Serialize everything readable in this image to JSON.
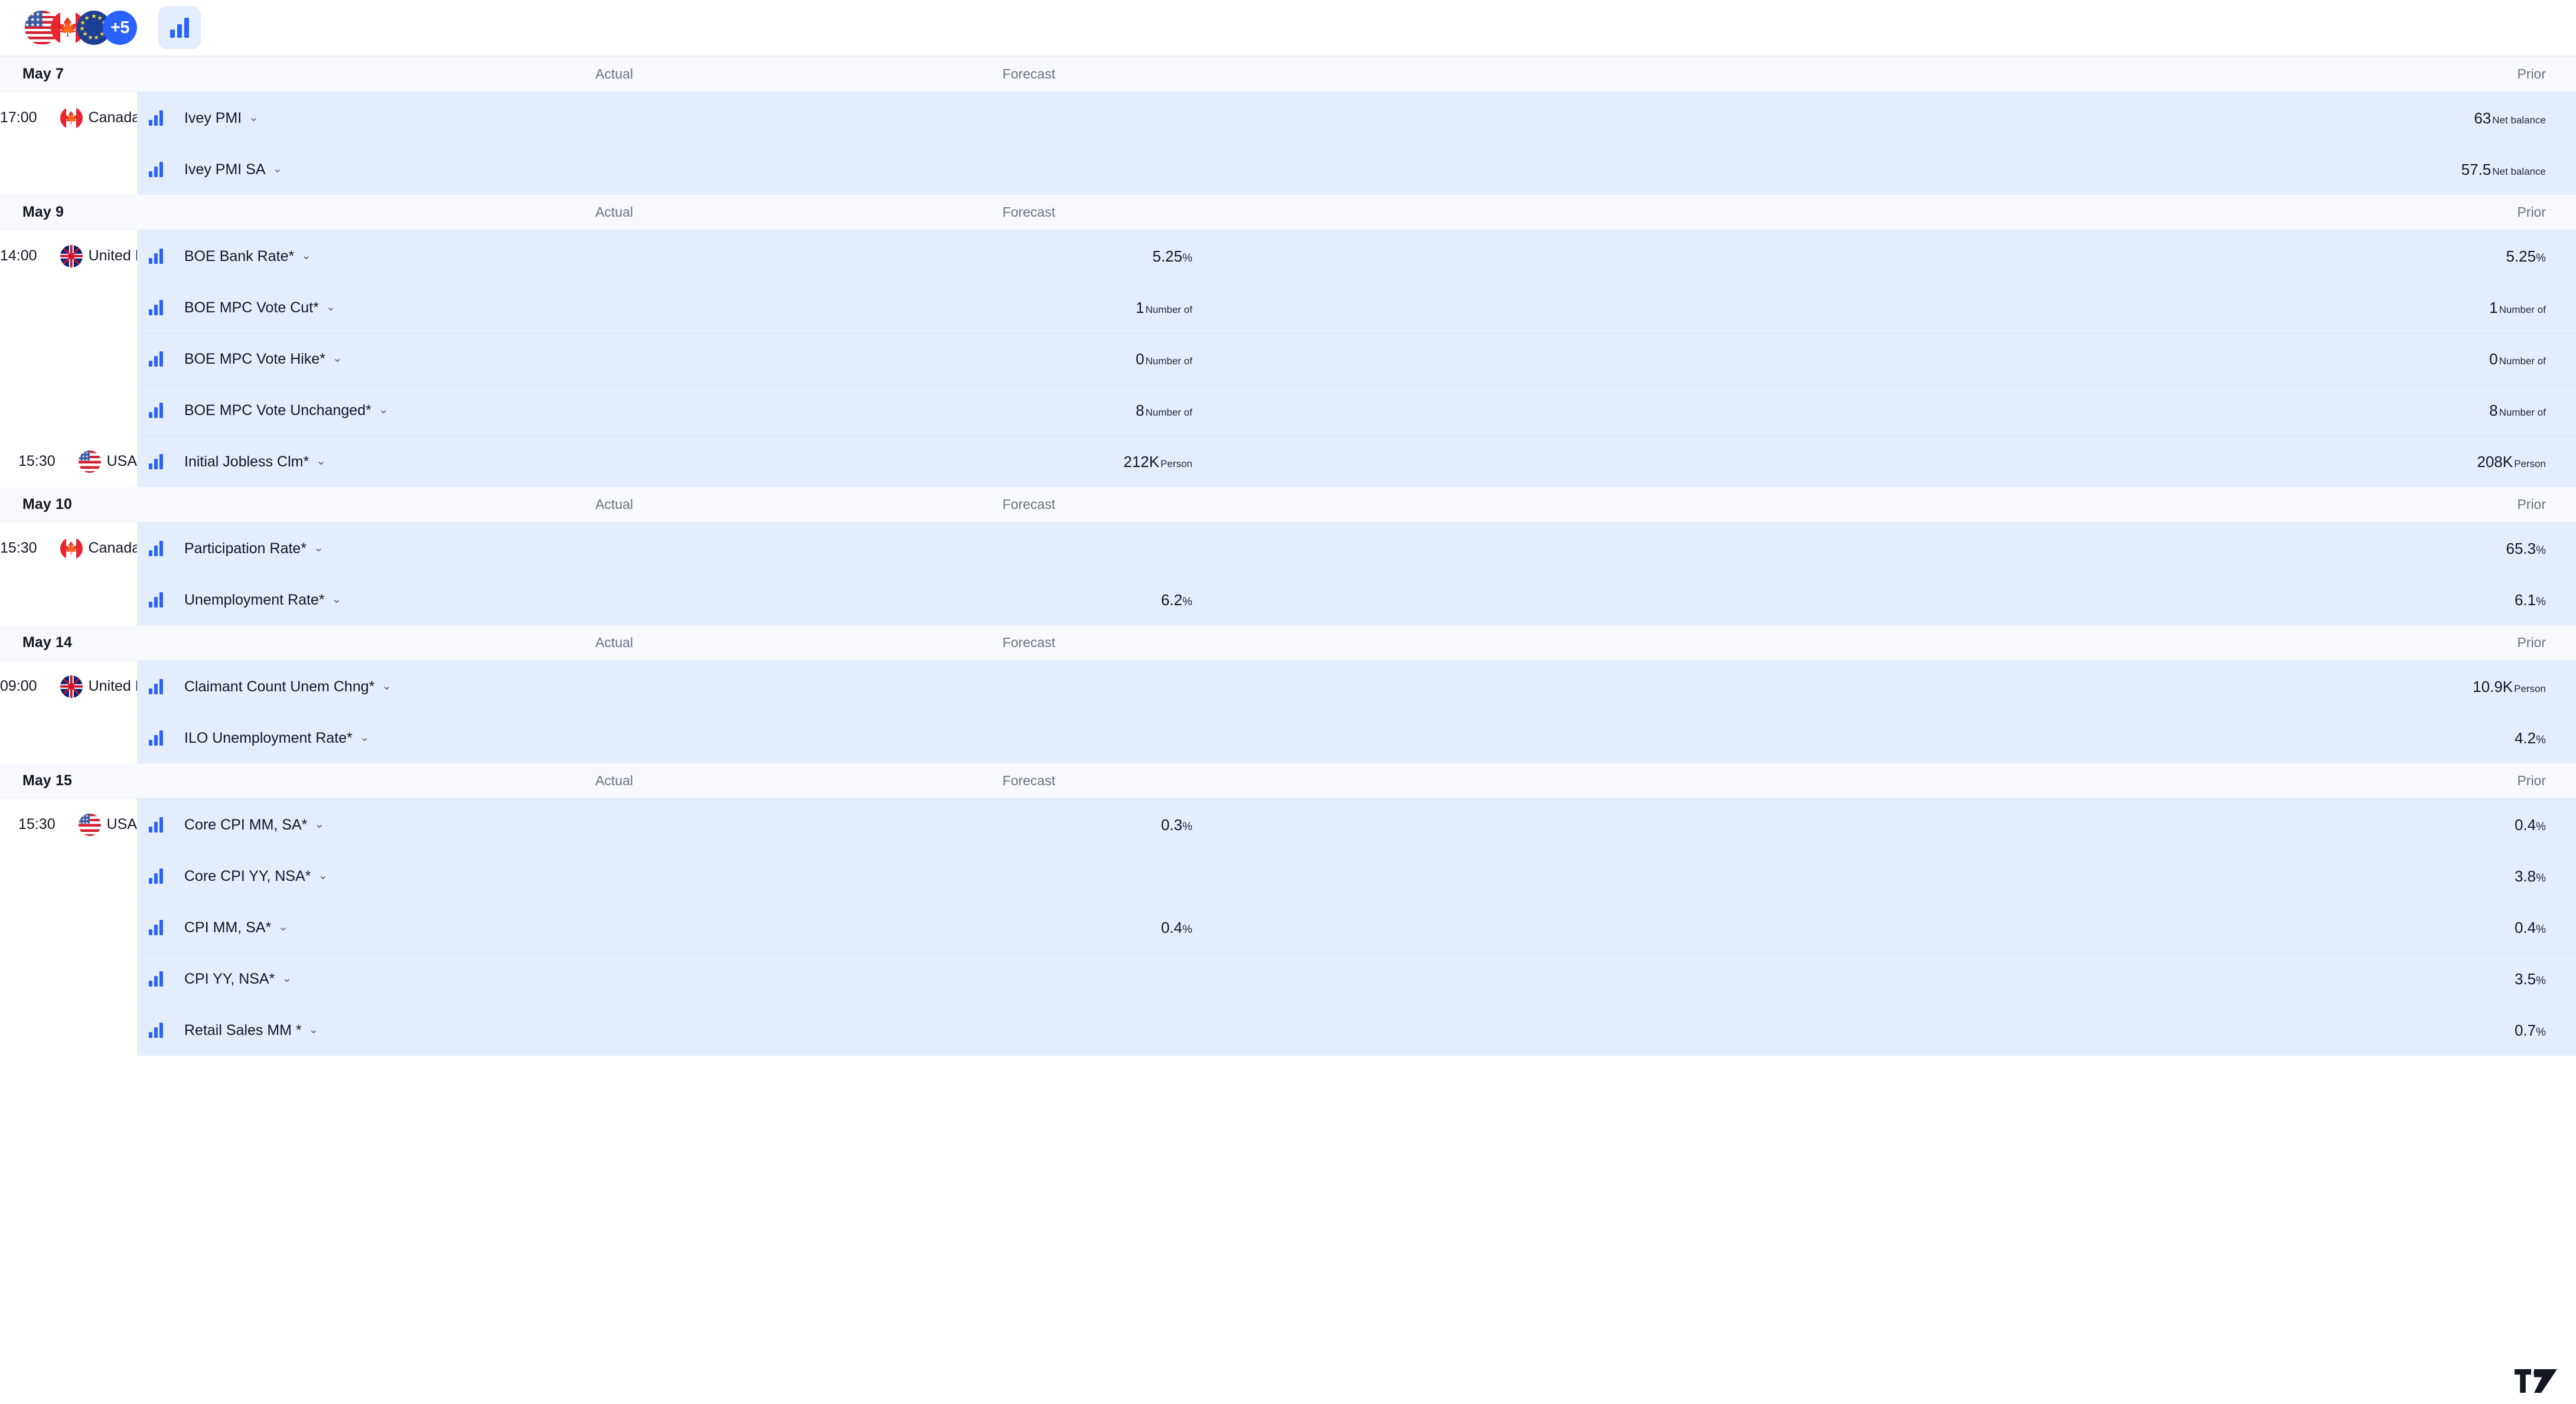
{
  "toolbar": {
    "country_filter": {
      "name": "country-filter",
      "flags": [
        "usa",
        "canada",
        "eu"
      ],
      "more_label": "+5"
    },
    "importance_filter": {
      "name": "importance-filter",
      "icon": "bar-chart-icon"
    }
  },
  "columns": {
    "actual": "Actual",
    "forecast": "Forecast",
    "prior": "Prior"
  },
  "accent": "#2962ff",
  "row_bg": "#e3edfb",
  "groups": [
    {
      "date": "May 7",
      "events": [
        {
          "time": "17:00",
          "country": "Canada",
          "flag": "canada",
          "name": "Ivey PMI",
          "actual": "",
          "actual_unit": "",
          "forecast": "",
          "forecast_unit": "",
          "prior": "63",
          "prior_unit": "Net balance"
        },
        {
          "time": "",
          "country": "",
          "flag": "",
          "name": "Ivey PMI SA",
          "actual": "",
          "actual_unit": "",
          "forecast": "",
          "forecast_unit": "",
          "prior": "57.5",
          "prior_unit": "Net balance"
        }
      ]
    },
    {
      "date": "May 9",
      "events": [
        {
          "time": "14:00",
          "country": "United Kingdom",
          "flag": "uk",
          "name": "BOE Bank Rate*",
          "actual": "",
          "actual_unit": "",
          "forecast": "5.25",
          "forecast_unit": "%",
          "prior": "5.25",
          "prior_unit": "%"
        },
        {
          "time": "",
          "country": "",
          "flag": "",
          "name": "BOE MPC Vote Cut*",
          "actual": "",
          "actual_unit": "",
          "forecast": "1",
          "forecast_unit": "Number of",
          "prior": "1",
          "prior_unit": "Number of"
        },
        {
          "time": "",
          "country": "",
          "flag": "",
          "name": "BOE MPC Vote Hike*",
          "actual": "",
          "actual_unit": "",
          "forecast": "0",
          "forecast_unit": "Number of",
          "prior": "0",
          "prior_unit": "Number of"
        },
        {
          "time": "",
          "country": "",
          "flag": "",
          "name": "BOE MPC Vote Unchanged*",
          "actual": "",
          "actual_unit": "",
          "forecast": "8",
          "forecast_unit": "Number of",
          "prior": "8",
          "prior_unit": "Number of"
        },
        {
          "time": "15:30",
          "country": "USA",
          "flag": "usa",
          "name": "Initial Jobless Clm*",
          "actual": "",
          "actual_unit": "",
          "forecast": "212K",
          "forecast_unit": "Person",
          "prior": "208K",
          "prior_unit": "Person"
        }
      ]
    },
    {
      "date": "May 10",
      "events": [
        {
          "time": "15:30",
          "country": "Canada",
          "flag": "canada",
          "name": "Participation Rate*",
          "actual": "",
          "actual_unit": "",
          "forecast": "",
          "forecast_unit": "",
          "prior": "65.3",
          "prior_unit": "%"
        },
        {
          "time": "",
          "country": "",
          "flag": "",
          "name": "Unemployment Rate*",
          "actual": "",
          "actual_unit": "",
          "forecast": "6.2",
          "forecast_unit": "%",
          "prior": "6.1",
          "prior_unit": "%"
        }
      ]
    },
    {
      "date": "May 14",
      "events": [
        {
          "time": "09:00",
          "country": "United Kingdom",
          "flag": "uk",
          "name": "Claimant Count Unem Chng*",
          "actual": "",
          "actual_unit": "",
          "forecast": "",
          "forecast_unit": "",
          "prior": "10.9K",
          "prior_unit": "Person"
        },
        {
          "time": "",
          "country": "",
          "flag": "",
          "name": "ILO Unemployment Rate*",
          "actual": "",
          "actual_unit": "",
          "forecast": "",
          "forecast_unit": "",
          "prior": "4.2",
          "prior_unit": "%"
        }
      ]
    },
    {
      "date": "May 15",
      "events": [
        {
          "time": "15:30",
          "country": "USA",
          "flag": "usa",
          "name": "Core CPI MM, SA*",
          "actual": "",
          "actual_unit": "",
          "forecast": "0.3",
          "forecast_unit": "%",
          "prior": "0.4",
          "prior_unit": "%"
        },
        {
          "time": "",
          "country": "",
          "flag": "",
          "name": "Core CPI YY, NSA*",
          "actual": "",
          "actual_unit": "",
          "forecast": "",
          "forecast_unit": "",
          "prior": "3.8",
          "prior_unit": "%"
        },
        {
          "time": "",
          "country": "",
          "flag": "",
          "name": "CPI MM, SA*",
          "actual": "",
          "actual_unit": "",
          "forecast": "0.4",
          "forecast_unit": "%",
          "prior": "0.4",
          "prior_unit": "%"
        },
        {
          "time": "",
          "country": "",
          "flag": "",
          "name": "CPI YY, NSA*",
          "actual": "",
          "actual_unit": "",
          "forecast": "",
          "forecast_unit": "",
          "prior": "3.5",
          "prior_unit": "%"
        },
        {
          "time": "",
          "country": "",
          "flag": "",
          "name": "Retail Sales MM *",
          "actual": "",
          "actual_unit": "",
          "forecast": "",
          "forecast_unit": "",
          "prior": "0.7",
          "prior_unit": "%"
        }
      ]
    }
  ],
  "branding": {
    "logo": "tradingview-logo"
  }
}
